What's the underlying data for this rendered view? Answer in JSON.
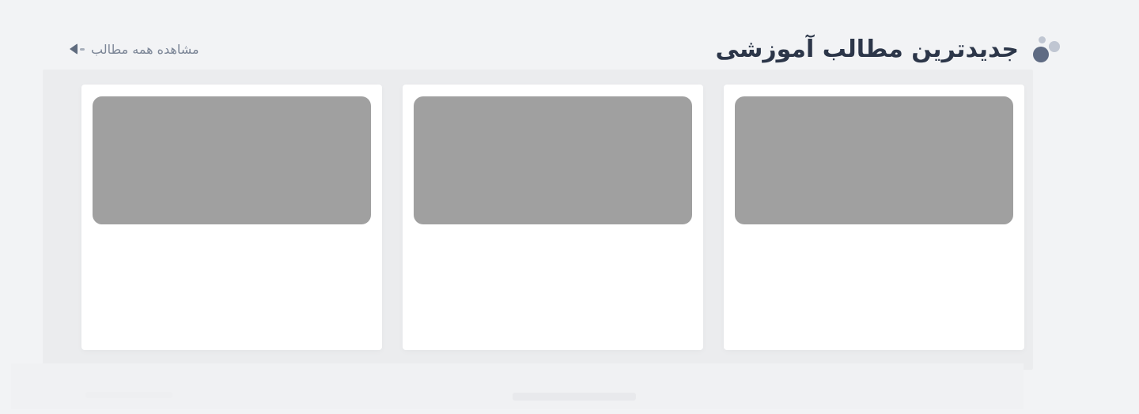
{
  "section": {
    "title": "جدیدترین مطالب آموزشی",
    "see_all_label": "مشاهده همه مطالب"
  },
  "icons": {
    "title_decoration": "dots-icon",
    "see_all_arrow": "arrow-left-icon"
  },
  "cards": [
    {
      "image": "placeholder"
    },
    {
      "image": "placeholder"
    },
    {
      "image": "placeholder"
    }
  ],
  "colors": {
    "background": "#f2f3f5",
    "title": "#2c3649",
    "link": "#7b8596",
    "thumb_placeholder": "#a0a0a0",
    "accent_dot": "#5f6b83"
  }
}
